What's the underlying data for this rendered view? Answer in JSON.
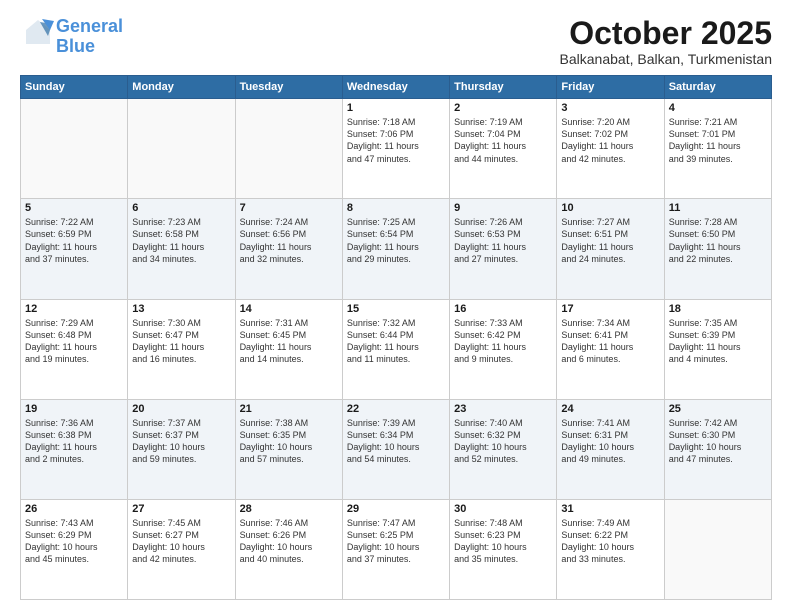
{
  "logo": {
    "line1": "General",
    "line2": "Blue"
  },
  "title": "October 2025",
  "location": "Balkanabat, Balkan, Turkmenistan",
  "days_header": [
    "Sunday",
    "Monday",
    "Tuesday",
    "Wednesday",
    "Thursday",
    "Friday",
    "Saturday"
  ],
  "weeks": [
    {
      "stripe": false,
      "days": [
        {
          "num": "",
          "info": ""
        },
        {
          "num": "",
          "info": ""
        },
        {
          "num": "",
          "info": ""
        },
        {
          "num": "1",
          "info": "Sunrise: 7:18 AM\nSunset: 7:06 PM\nDaylight: 11 hours\nand 47 minutes."
        },
        {
          "num": "2",
          "info": "Sunrise: 7:19 AM\nSunset: 7:04 PM\nDaylight: 11 hours\nand 44 minutes."
        },
        {
          "num": "3",
          "info": "Sunrise: 7:20 AM\nSunset: 7:02 PM\nDaylight: 11 hours\nand 42 minutes."
        },
        {
          "num": "4",
          "info": "Sunrise: 7:21 AM\nSunset: 7:01 PM\nDaylight: 11 hours\nand 39 minutes."
        }
      ]
    },
    {
      "stripe": true,
      "days": [
        {
          "num": "5",
          "info": "Sunrise: 7:22 AM\nSunset: 6:59 PM\nDaylight: 11 hours\nand 37 minutes."
        },
        {
          "num": "6",
          "info": "Sunrise: 7:23 AM\nSunset: 6:58 PM\nDaylight: 11 hours\nand 34 minutes."
        },
        {
          "num": "7",
          "info": "Sunrise: 7:24 AM\nSunset: 6:56 PM\nDaylight: 11 hours\nand 32 minutes."
        },
        {
          "num": "8",
          "info": "Sunrise: 7:25 AM\nSunset: 6:54 PM\nDaylight: 11 hours\nand 29 minutes."
        },
        {
          "num": "9",
          "info": "Sunrise: 7:26 AM\nSunset: 6:53 PM\nDaylight: 11 hours\nand 27 minutes."
        },
        {
          "num": "10",
          "info": "Sunrise: 7:27 AM\nSunset: 6:51 PM\nDaylight: 11 hours\nand 24 minutes."
        },
        {
          "num": "11",
          "info": "Sunrise: 7:28 AM\nSunset: 6:50 PM\nDaylight: 11 hours\nand 22 minutes."
        }
      ]
    },
    {
      "stripe": false,
      "days": [
        {
          "num": "12",
          "info": "Sunrise: 7:29 AM\nSunset: 6:48 PM\nDaylight: 11 hours\nand 19 minutes."
        },
        {
          "num": "13",
          "info": "Sunrise: 7:30 AM\nSunset: 6:47 PM\nDaylight: 11 hours\nand 16 minutes."
        },
        {
          "num": "14",
          "info": "Sunrise: 7:31 AM\nSunset: 6:45 PM\nDaylight: 11 hours\nand 14 minutes."
        },
        {
          "num": "15",
          "info": "Sunrise: 7:32 AM\nSunset: 6:44 PM\nDaylight: 11 hours\nand 11 minutes."
        },
        {
          "num": "16",
          "info": "Sunrise: 7:33 AM\nSunset: 6:42 PM\nDaylight: 11 hours\nand 9 minutes."
        },
        {
          "num": "17",
          "info": "Sunrise: 7:34 AM\nSunset: 6:41 PM\nDaylight: 11 hours\nand 6 minutes."
        },
        {
          "num": "18",
          "info": "Sunrise: 7:35 AM\nSunset: 6:39 PM\nDaylight: 11 hours\nand 4 minutes."
        }
      ]
    },
    {
      "stripe": true,
      "days": [
        {
          "num": "19",
          "info": "Sunrise: 7:36 AM\nSunset: 6:38 PM\nDaylight: 11 hours\nand 2 minutes."
        },
        {
          "num": "20",
          "info": "Sunrise: 7:37 AM\nSunset: 6:37 PM\nDaylight: 10 hours\nand 59 minutes."
        },
        {
          "num": "21",
          "info": "Sunrise: 7:38 AM\nSunset: 6:35 PM\nDaylight: 10 hours\nand 57 minutes."
        },
        {
          "num": "22",
          "info": "Sunrise: 7:39 AM\nSunset: 6:34 PM\nDaylight: 10 hours\nand 54 minutes."
        },
        {
          "num": "23",
          "info": "Sunrise: 7:40 AM\nSunset: 6:32 PM\nDaylight: 10 hours\nand 52 minutes."
        },
        {
          "num": "24",
          "info": "Sunrise: 7:41 AM\nSunset: 6:31 PM\nDaylight: 10 hours\nand 49 minutes."
        },
        {
          "num": "25",
          "info": "Sunrise: 7:42 AM\nSunset: 6:30 PM\nDaylight: 10 hours\nand 47 minutes."
        }
      ]
    },
    {
      "stripe": false,
      "days": [
        {
          "num": "26",
          "info": "Sunrise: 7:43 AM\nSunset: 6:29 PM\nDaylight: 10 hours\nand 45 minutes."
        },
        {
          "num": "27",
          "info": "Sunrise: 7:45 AM\nSunset: 6:27 PM\nDaylight: 10 hours\nand 42 minutes."
        },
        {
          "num": "28",
          "info": "Sunrise: 7:46 AM\nSunset: 6:26 PM\nDaylight: 10 hours\nand 40 minutes."
        },
        {
          "num": "29",
          "info": "Sunrise: 7:47 AM\nSunset: 6:25 PM\nDaylight: 10 hours\nand 37 minutes."
        },
        {
          "num": "30",
          "info": "Sunrise: 7:48 AM\nSunset: 6:23 PM\nDaylight: 10 hours\nand 35 minutes."
        },
        {
          "num": "31",
          "info": "Sunrise: 7:49 AM\nSunset: 6:22 PM\nDaylight: 10 hours\nand 33 minutes."
        },
        {
          "num": "",
          "info": ""
        }
      ]
    }
  ]
}
